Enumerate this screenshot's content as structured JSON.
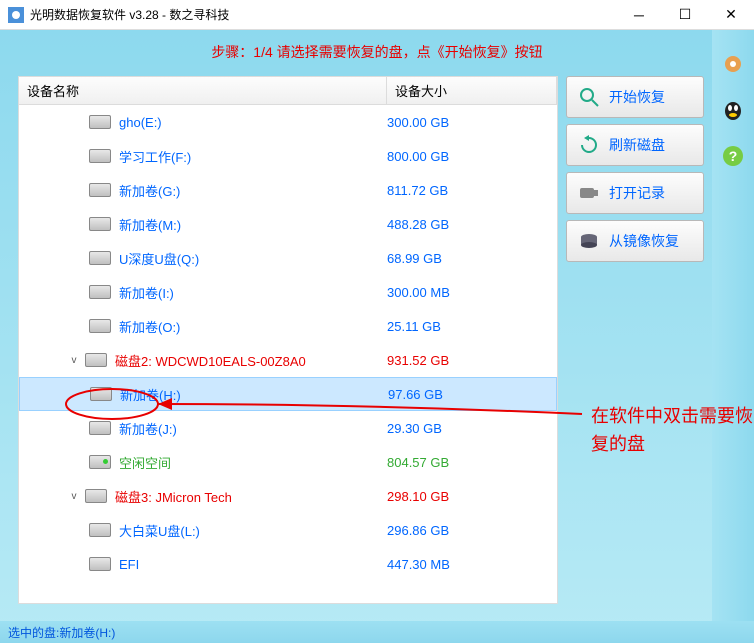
{
  "window": {
    "title": "光明数据恢复软件 v3.28 - 数之寻科技"
  },
  "step": "步骤：1/4 请选择需要恢复的盘，点《开始恢复》按钮",
  "headers": {
    "name": "设备名称",
    "size": "设备大小"
  },
  "rows": [
    {
      "kind": "vol",
      "indent": 2,
      "name": "gho(E:)",
      "size": "300.00 GB"
    },
    {
      "kind": "vol",
      "indent": 2,
      "name": "学习工作(F:)",
      "size": "800.00 GB"
    },
    {
      "kind": "vol",
      "indent": 2,
      "name": "新加卷(G:)",
      "size": "811.72 GB"
    },
    {
      "kind": "vol",
      "indent": 2,
      "name": "新加卷(M:)",
      "size": "488.28 GB"
    },
    {
      "kind": "vol",
      "indent": 2,
      "name": "U深度U盘(Q:)",
      "size": "68.99 GB"
    },
    {
      "kind": "vol",
      "indent": 2,
      "name": "新加卷(I:)",
      "size": "300.00 MB"
    },
    {
      "kind": "vol",
      "indent": 2,
      "name": "新加卷(O:)",
      "size": "25.11 GB"
    },
    {
      "kind": "disk",
      "indent": 1,
      "name": "磁盘2: WDCWD10EALS-00Z8A0",
      "size": "931.52 GB",
      "expand": "v"
    },
    {
      "kind": "vol",
      "indent": 2,
      "name": "新加卷(H:)",
      "size": "97.66 GB",
      "selected": true
    },
    {
      "kind": "vol",
      "indent": 2,
      "name": "新加卷(J:)",
      "size": "29.30 GB"
    },
    {
      "kind": "free",
      "indent": 2,
      "name": "空闲空间",
      "size": "804.57 GB"
    },
    {
      "kind": "disk",
      "indent": 1,
      "name": "磁盘3: JMicron  Tech",
      "size": "298.10 GB",
      "expand": "v"
    },
    {
      "kind": "vol",
      "indent": 2,
      "name": "大白菜U盘(L:)",
      "size": "296.86 GB"
    },
    {
      "kind": "vol",
      "indent": 2,
      "name": "EFI",
      "size": "447.30 MB"
    }
  ],
  "buttons": {
    "start": "开始恢复",
    "refresh": "刷新磁盘",
    "log": "打开记录",
    "image": "从镜像恢复"
  },
  "status": "选中的盘:新加卷(H:)",
  "annotation": "在软件中双击需要恢复的盘",
  "toolbar_icons": [
    "gear-icon",
    "qq-icon",
    "help-icon"
  ]
}
